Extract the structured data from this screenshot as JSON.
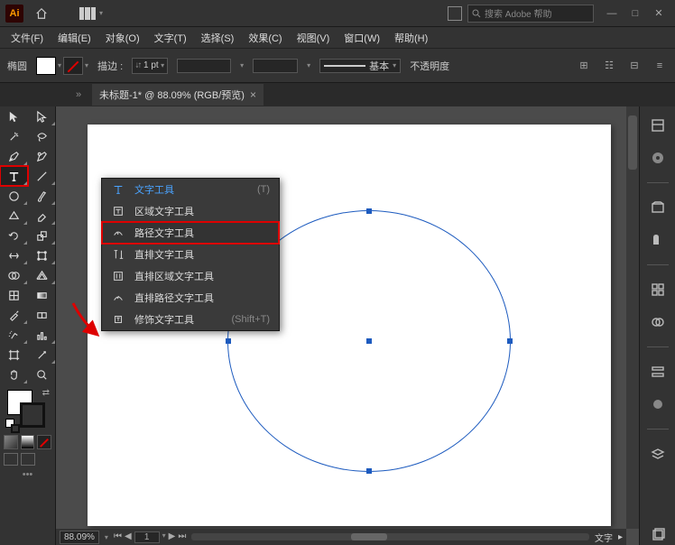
{
  "titlebar": {
    "search_placeholder": "搜索 Adobe 帮助",
    "win": {
      "min": "—",
      "max": "□",
      "close": "✕"
    }
  },
  "menubar": {
    "items": [
      "文件(F)",
      "编辑(E)",
      "对象(O)",
      "文字(T)",
      "选择(S)",
      "效果(C)",
      "视图(V)",
      "窗口(W)",
      "帮助(H)"
    ]
  },
  "controlbar": {
    "shape_label": "椭圆",
    "stroke_label": "描边 :",
    "stroke_value": "1 pt",
    "style_label": "基本",
    "opacity_label": "不透明度"
  },
  "tab": {
    "title": "未标题-1* @ 88.09% (RGB/预览)",
    "close": "×"
  },
  "flyout": {
    "items": [
      {
        "label": "文字工具",
        "shortcut": "(T)",
        "icon": "type"
      },
      {
        "label": "区域文字工具",
        "shortcut": "",
        "icon": "area-type"
      },
      {
        "label": "路径文字工具",
        "shortcut": "",
        "icon": "path-type"
      },
      {
        "label": "直排文字工具",
        "shortcut": "",
        "icon": "vert-type"
      },
      {
        "label": "直排区域文字工具",
        "shortcut": "",
        "icon": "vert-area"
      },
      {
        "label": "直排路径文字工具",
        "shortcut": "",
        "icon": "vert-path"
      },
      {
        "label": "修饰文字工具",
        "shortcut": "(Shift+T)",
        "icon": "touch-type"
      }
    ],
    "active_index": 0,
    "highlight_index": 2
  },
  "statusbar": {
    "zoom": "88.09%",
    "artboard_num": "1",
    "label": "文字"
  }
}
